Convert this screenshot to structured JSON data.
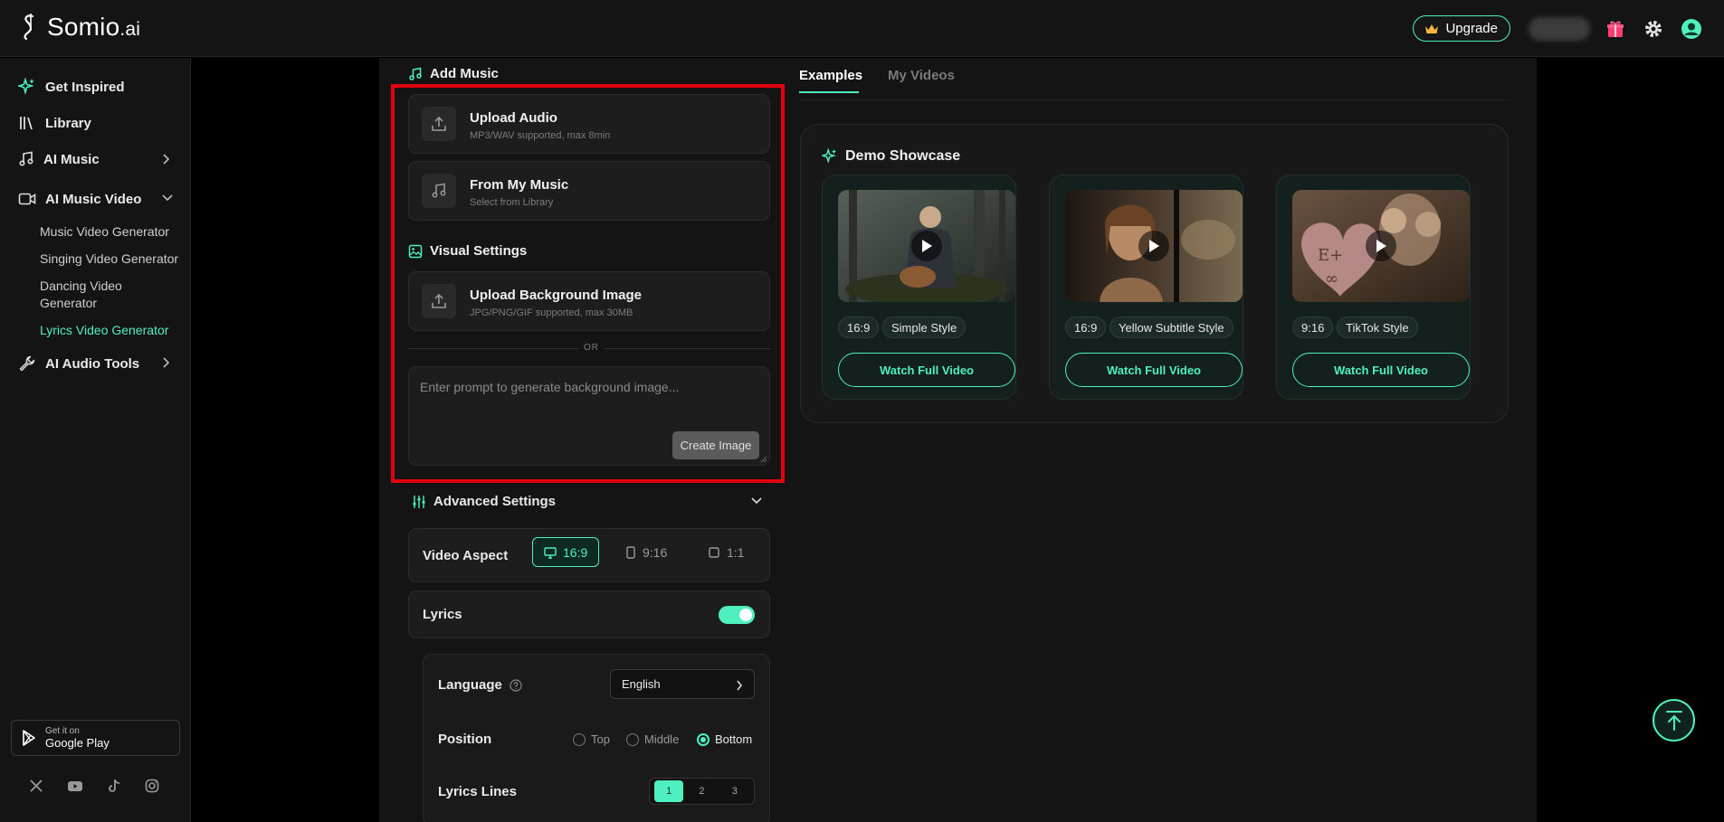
{
  "app": {
    "logo_text": "Somio",
    "logo_suffix": ".ai",
    "accent": "#4ef0c0",
    "highlight_color": "#e4000f"
  },
  "header": {
    "upgrade_label": "Upgrade",
    "icons": [
      "crown-icon",
      "gift-icon",
      "gear-icon",
      "user-avatar-icon"
    ]
  },
  "sidebar": {
    "items": [
      {
        "label": "Get Inspired",
        "icon": "sparkle-icon"
      },
      {
        "label": "Library",
        "icon": "library-icon"
      },
      {
        "label": "AI Music",
        "icon": "music-note-icon"
      },
      {
        "label": "AI Music Video",
        "icon": "video-camera-icon"
      },
      {
        "label": "AI Audio Tools",
        "icon": "wrench-icon"
      }
    ],
    "sub_items": [
      "Music Video Generator",
      "Singing Video Generator",
      "Dancing Video Generator",
      "Lyrics Video Generator"
    ],
    "google_play": {
      "small": "Get it on",
      "big": "Google Play"
    },
    "socials": [
      "x-icon",
      "youtube-icon",
      "tiktok-icon",
      "instagram-icon"
    ]
  },
  "form": {
    "add_music_title": "Add Music",
    "upload_audio": {
      "title": "Upload Audio",
      "sub": "MP3/WAV supported, max 8min"
    },
    "from_my_music": {
      "title": "From My Music",
      "sub": "Select from Library"
    },
    "visual_settings_title": "Visual Settings",
    "upload_bg": {
      "title": "Upload Background Image",
      "sub": "JPG/PNG/GIF supported, max 30MB"
    },
    "or_text": "OR",
    "prompt_placeholder": "Enter prompt to generate background image...",
    "create_image_label": "Create Image",
    "advanced_title": "Advanced Settings",
    "video_aspect_label": "Video Aspect",
    "aspects": [
      "16:9",
      "9:16",
      "1:1"
    ],
    "aspect_selected": "16:9",
    "lyrics_label": "Lyrics",
    "lyrics_enabled": true,
    "language_label": "Language",
    "language_value": "English",
    "position_label": "Position",
    "positions": [
      "Top",
      "Middle",
      "Bottom"
    ],
    "position_selected": "Bottom",
    "lines_label": "Lyrics Lines",
    "lines": [
      "1",
      "2",
      "3"
    ],
    "lines_selected": "1"
  },
  "tabs": {
    "active": "Examples",
    "inactive": "My Videos"
  },
  "showcase": {
    "title": "Demo Showcase",
    "cards": [
      {
        "ratio": "16:9",
        "style": "Simple Style",
        "button": "Watch Full Video"
      },
      {
        "ratio": "16:9",
        "style": "Yellow Subtitle Style",
        "button": "Watch Full Video"
      },
      {
        "ratio": "9:16",
        "style": "TikTok Style",
        "button": "Watch Full Video"
      }
    ]
  }
}
